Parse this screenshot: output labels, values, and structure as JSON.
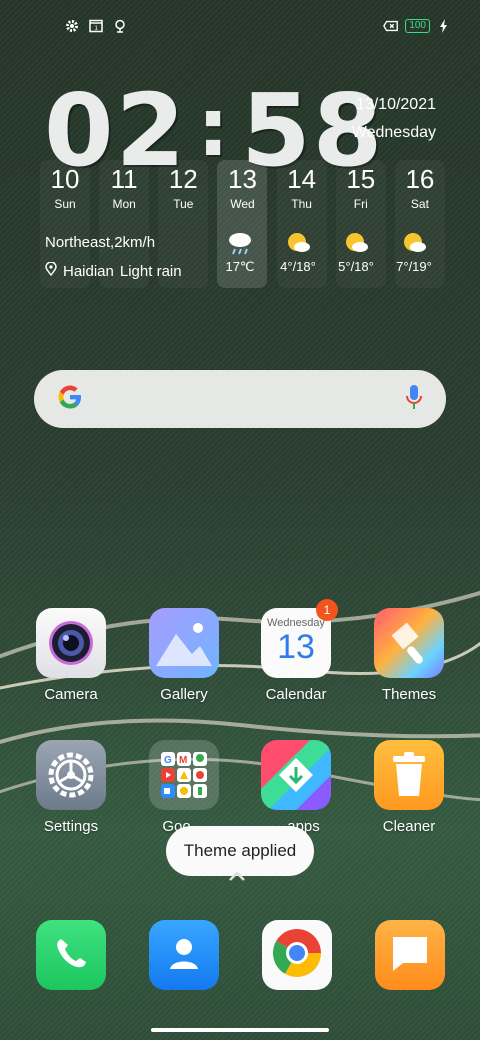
{
  "status_bar": {
    "icons": [
      "gear-icon",
      "calendar-1-icon",
      "location-icon"
    ],
    "right_icons": [
      "sim-off-icon",
      "battery-icon",
      "charging-icon"
    ],
    "battery_level": "100"
  },
  "clock": {
    "hours": "02",
    "separator": ":",
    "minutes": "58",
    "date": "13/10/2021",
    "weekday": "Wednesday"
  },
  "week": [
    {
      "num": "10",
      "label": "Sun"
    },
    {
      "num": "11",
      "label": "Mon"
    },
    {
      "num": "12",
      "label": "Tue"
    },
    {
      "num": "13",
      "label": "Wed"
    },
    {
      "num": "14",
      "label": "Thu"
    },
    {
      "num": "15",
      "label": "Fri"
    },
    {
      "num": "16",
      "label": "Sat"
    }
  ],
  "forecast": [
    {
      "icon": "rain-cloud-icon",
      "temp": "17℃"
    },
    {
      "icon": "partly-sunny-icon",
      "temp": "4°/18°"
    },
    {
      "icon": "partly-sunny-icon",
      "temp": "5°/18°"
    },
    {
      "icon": "partly-sunny-icon",
      "temp": "7°/19°"
    }
  ],
  "weather": {
    "wind": "Northeast,2km/h",
    "location": "Haidian",
    "condition": "Light rain"
  },
  "search": {
    "logo": "google-g-icon",
    "mic": "mic-icon"
  },
  "apps": [
    {
      "name": "Camera",
      "icon": "camera-icon"
    },
    {
      "name": "Gallery",
      "icon": "gallery-icon"
    },
    {
      "name": "Calendar",
      "icon": "calendar-icon",
      "top_text": "Wednesday",
      "day": "13",
      "badge": "1"
    },
    {
      "name": "Themes",
      "icon": "themes-icon"
    },
    {
      "name": "Settings",
      "icon": "settings-icon"
    },
    {
      "name": "Goo…",
      "icon": "google-folder-icon"
    },
    {
      "name": "…apps",
      "icon": "app-market-icon"
    },
    {
      "name": "Cleaner",
      "icon": "cleaner-icon"
    }
  ],
  "dock": [
    {
      "icon": "phone-icon"
    },
    {
      "icon": "contacts-icon"
    },
    {
      "icon": "chrome-icon"
    },
    {
      "icon": "messages-icon"
    }
  ],
  "toast": "Theme applied",
  "colors": {
    "battery": "#3ddc84",
    "badge": "#f2541b"
  }
}
